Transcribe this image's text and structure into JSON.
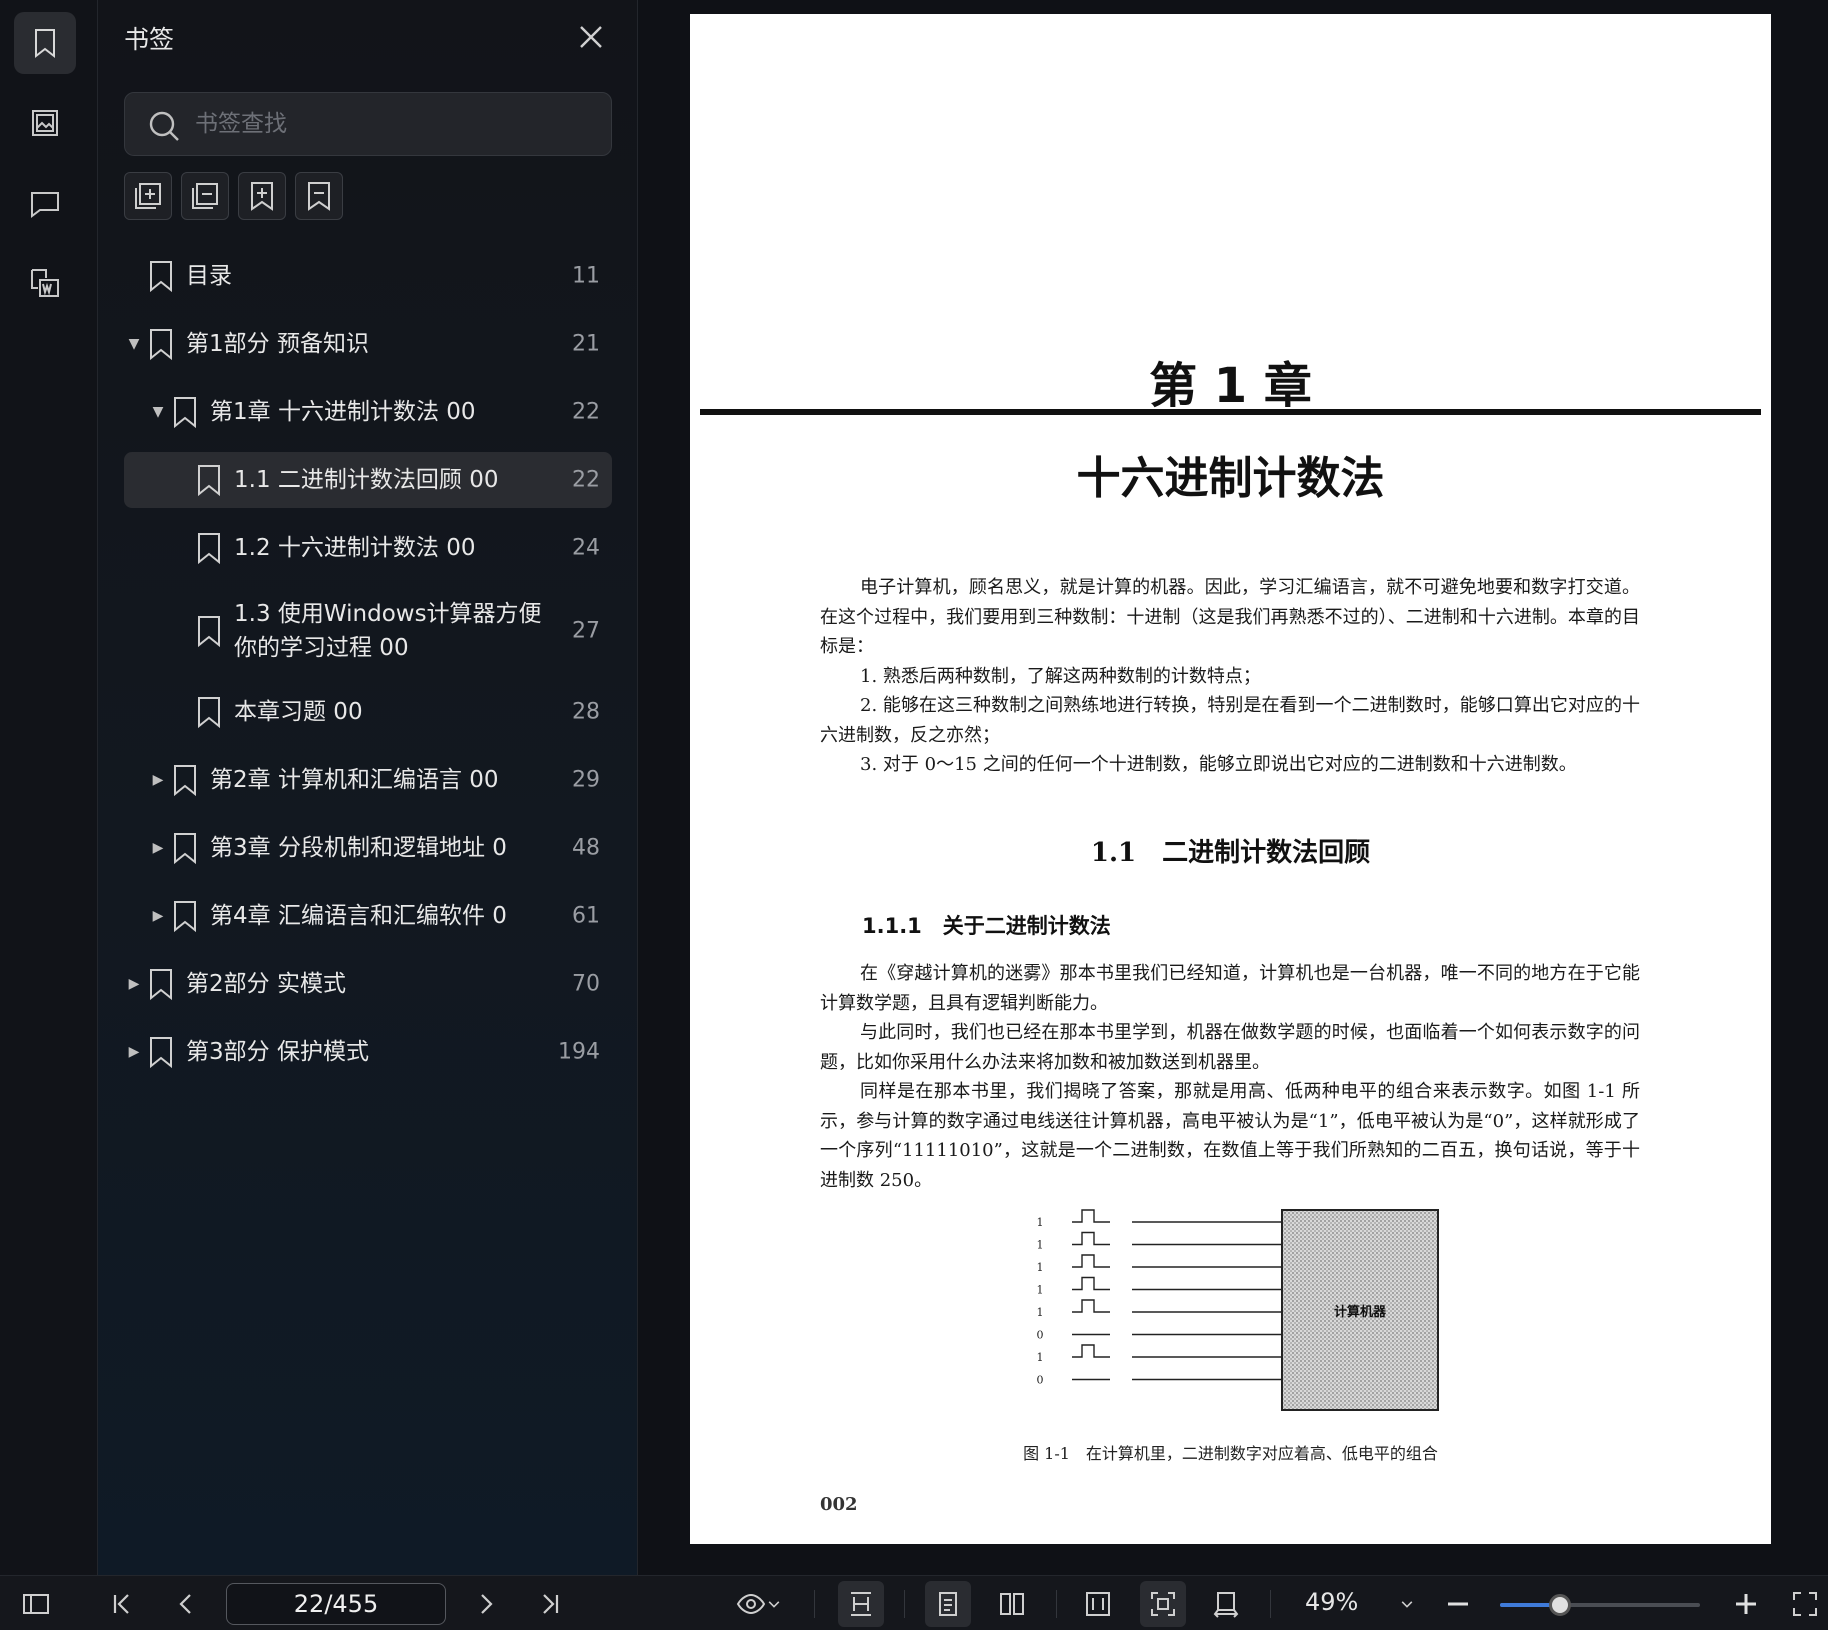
{
  "panel": {
    "title": "书签",
    "search_placeholder": "书签查找"
  },
  "icons": {
    "rail": [
      "bookmark-icon",
      "image-icon",
      "comment-icon",
      "word-convert-icon"
    ],
    "tools": [
      "expand-all-icon",
      "collapse-all-icon",
      "add-bookmark-icon",
      "remove-bookmark-icon"
    ]
  },
  "bookmarks": [
    {
      "label": "目录",
      "page": "11",
      "level": 0,
      "arrow": "",
      "selected": false
    },
    {
      "label": "第1部分 预备知识",
      "page": "21",
      "level": 0,
      "arrow": "▼",
      "selected": false
    },
    {
      "label": "第1章 十六进制计数法 00",
      "page": "22",
      "level": 1,
      "arrow": "▼",
      "selected": false
    },
    {
      "label": "1.1 二进制计数法回顾 00",
      "page": "22",
      "level": 2,
      "arrow": "",
      "selected": true
    },
    {
      "label": "1.2 十六进制计数法 00",
      "page": "24",
      "level": 2,
      "arrow": "",
      "selected": false
    },
    {
      "label": "1.3 使用Windows计算器方便\n你的学习过程 00",
      "page": "27",
      "level": 2,
      "arrow": "",
      "selected": false,
      "tall": true
    },
    {
      "label": "本章习题 00",
      "page": "28",
      "level": 2,
      "arrow": "",
      "selected": false
    },
    {
      "label": "第2章 计算机和汇编语言 00",
      "page": "29",
      "level": 1,
      "arrow": "▶",
      "selected": false
    },
    {
      "label": "第3章 分段机制和逻辑地址 0",
      "page": "48",
      "level": 1,
      "arrow": "▶",
      "selected": false
    },
    {
      "label": "第4章 汇编语言和汇编软件 0",
      "page": "61",
      "level": 1,
      "arrow": "▶",
      "selected": false
    },
    {
      "label": "第2部分 实模式",
      "page": "70",
      "level": 0,
      "arrow": "▶",
      "selected": false
    },
    {
      "label": "第3部分 保护模式",
      "page": "194",
      "level": 0,
      "arrow": "▶",
      "selected": false
    }
  ],
  "document": {
    "chapter_number": "第 1 章",
    "chapter_title": "十六进制计数法",
    "intro_paragraphs": [
      "电子计算机，顾名思义，就是计算的机器。因此，学习汇编语言，就不可避免地要和数字打交道。在这个过程中，我们要用到三种数制：十进制（这是我们再熟悉不过的）、二进制和十六进制。本章的目标是：",
      "1. 熟悉后两种数制，了解这两种数制的计数特点；",
      "2. 能够在这三种数制之间熟练地进行转换，特别是在看到一个二进制数时，能够口算出它对应的十六进制数，反之亦然；",
      "3. 对于 0～15 之间的任何一个十进制数，能够立即说出它对应的二进制数和十六进制数。"
    ],
    "section_heading": "1.1　二进制计数法回顾",
    "subsection_heading": "1.1.1　关于二进制计数法",
    "body_paragraphs": [
      "在《穿越计算机的迷雾》那本书里我们已经知道，计算机也是一台机器，唯一不同的地方在于它能计算数学题，且具有逻辑判断能力。",
      "与此同时，我们也已经在那本书里学到，机器在做数学题的时候，也面临着一个如何表示数字的问题，比如你采用什么办法来将加数和被加数送到机器里。",
      "同样是在那本书里，我们揭晓了答案，那就是用高、低两种电平的组合来表示数字。如图 1-1 所示，参与计算的数字通过电线送往计算机器，高电平被认为是“1”，低电平被认为是“0”，这样就形成了一个序列“11111010”，这就是一个二进制数，在数值上等于我们所熟知的二百五，换句话说，等于十进制数 250。"
    ],
    "figure": {
      "bits": [
        "1",
        "1",
        "1",
        "1",
        "1",
        "0",
        "1",
        "0"
      ],
      "box_label": "计算机器",
      "caption": "图 1-1　在计算机里，二进制数字对应着高、低电平的组合"
    },
    "printed_page_number": "002"
  },
  "toolbar": {
    "page_indicator": "22/455",
    "zoom": "49%",
    "zoom_fraction": 0.3
  }
}
